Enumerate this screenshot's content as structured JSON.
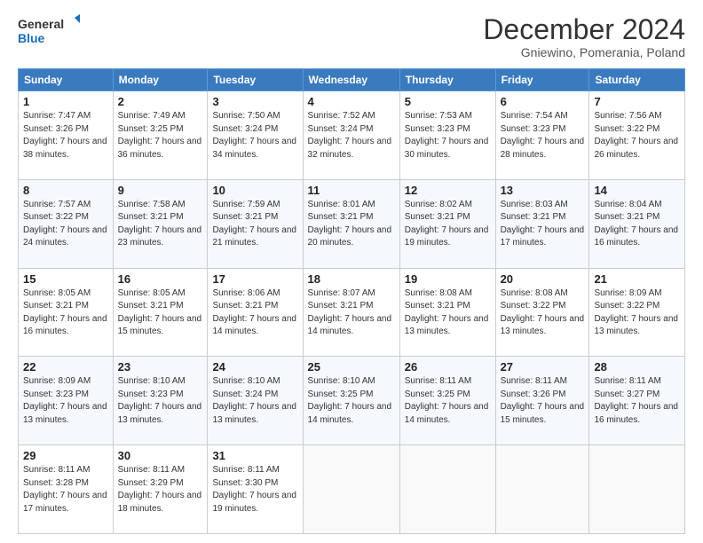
{
  "logo": {
    "line1": "General",
    "line2": "Blue"
  },
  "title": "December 2024",
  "subtitle": "Gniewino, Pomerania, Poland",
  "days_of_week": [
    "Sunday",
    "Monday",
    "Tuesday",
    "Wednesday",
    "Thursday",
    "Friday",
    "Saturday"
  ],
  "weeks": [
    [
      {
        "day": "1",
        "sunrise": "7:47 AM",
        "sunset": "3:26 PM",
        "daylight": "7 hours and 38 minutes."
      },
      {
        "day": "2",
        "sunrise": "7:49 AM",
        "sunset": "3:25 PM",
        "daylight": "7 hours and 36 minutes."
      },
      {
        "day": "3",
        "sunrise": "7:50 AM",
        "sunset": "3:24 PM",
        "daylight": "7 hours and 34 minutes."
      },
      {
        "day": "4",
        "sunrise": "7:52 AM",
        "sunset": "3:24 PM",
        "daylight": "7 hours and 32 minutes."
      },
      {
        "day": "5",
        "sunrise": "7:53 AM",
        "sunset": "3:23 PM",
        "daylight": "7 hours and 30 minutes."
      },
      {
        "day": "6",
        "sunrise": "7:54 AM",
        "sunset": "3:23 PM",
        "daylight": "7 hours and 28 minutes."
      },
      {
        "day": "7",
        "sunrise": "7:56 AM",
        "sunset": "3:22 PM",
        "daylight": "7 hours and 26 minutes."
      }
    ],
    [
      {
        "day": "8",
        "sunrise": "7:57 AM",
        "sunset": "3:22 PM",
        "daylight": "7 hours and 24 minutes."
      },
      {
        "day": "9",
        "sunrise": "7:58 AM",
        "sunset": "3:21 PM",
        "daylight": "7 hours and 23 minutes."
      },
      {
        "day": "10",
        "sunrise": "7:59 AM",
        "sunset": "3:21 PM",
        "daylight": "7 hours and 21 minutes."
      },
      {
        "day": "11",
        "sunrise": "8:01 AM",
        "sunset": "3:21 PM",
        "daylight": "7 hours and 20 minutes."
      },
      {
        "day": "12",
        "sunrise": "8:02 AM",
        "sunset": "3:21 PM",
        "daylight": "7 hours and 19 minutes."
      },
      {
        "day": "13",
        "sunrise": "8:03 AM",
        "sunset": "3:21 PM",
        "daylight": "7 hours and 17 minutes."
      },
      {
        "day": "14",
        "sunrise": "8:04 AM",
        "sunset": "3:21 PM",
        "daylight": "7 hours and 16 minutes."
      }
    ],
    [
      {
        "day": "15",
        "sunrise": "8:05 AM",
        "sunset": "3:21 PM",
        "daylight": "7 hours and 16 minutes."
      },
      {
        "day": "16",
        "sunrise": "8:05 AM",
        "sunset": "3:21 PM",
        "daylight": "7 hours and 15 minutes."
      },
      {
        "day": "17",
        "sunrise": "8:06 AM",
        "sunset": "3:21 PM",
        "daylight": "7 hours and 14 minutes."
      },
      {
        "day": "18",
        "sunrise": "8:07 AM",
        "sunset": "3:21 PM",
        "daylight": "7 hours and 14 minutes."
      },
      {
        "day": "19",
        "sunrise": "8:08 AM",
        "sunset": "3:21 PM",
        "daylight": "7 hours and 13 minutes."
      },
      {
        "day": "20",
        "sunrise": "8:08 AM",
        "sunset": "3:22 PM",
        "daylight": "7 hours and 13 minutes."
      },
      {
        "day": "21",
        "sunrise": "8:09 AM",
        "sunset": "3:22 PM",
        "daylight": "7 hours and 13 minutes."
      }
    ],
    [
      {
        "day": "22",
        "sunrise": "8:09 AM",
        "sunset": "3:23 PM",
        "daylight": "7 hours and 13 minutes."
      },
      {
        "day": "23",
        "sunrise": "8:10 AM",
        "sunset": "3:23 PM",
        "daylight": "7 hours and 13 minutes."
      },
      {
        "day": "24",
        "sunrise": "8:10 AM",
        "sunset": "3:24 PM",
        "daylight": "7 hours and 13 minutes."
      },
      {
        "day": "25",
        "sunrise": "8:10 AM",
        "sunset": "3:25 PM",
        "daylight": "7 hours and 14 minutes."
      },
      {
        "day": "26",
        "sunrise": "8:11 AM",
        "sunset": "3:25 PM",
        "daylight": "7 hours and 14 minutes."
      },
      {
        "day": "27",
        "sunrise": "8:11 AM",
        "sunset": "3:26 PM",
        "daylight": "7 hours and 15 minutes."
      },
      {
        "day": "28",
        "sunrise": "8:11 AM",
        "sunset": "3:27 PM",
        "daylight": "7 hours and 16 minutes."
      }
    ],
    [
      {
        "day": "29",
        "sunrise": "8:11 AM",
        "sunset": "3:28 PM",
        "daylight": "7 hours and 17 minutes."
      },
      {
        "day": "30",
        "sunrise": "8:11 AM",
        "sunset": "3:29 PM",
        "daylight": "7 hours and 18 minutes."
      },
      {
        "day": "31",
        "sunrise": "8:11 AM",
        "sunset": "3:30 PM",
        "daylight": "7 hours and 19 minutes."
      },
      null,
      null,
      null,
      null
    ]
  ],
  "labels": {
    "sunrise": "Sunrise:",
    "sunset": "Sunset:",
    "daylight": "Daylight:"
  }
}
